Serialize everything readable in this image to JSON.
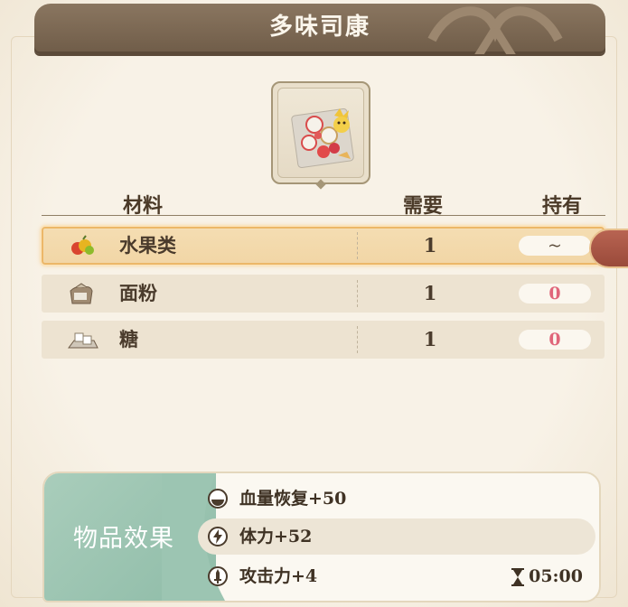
{
  "title": "多味司康",
  "table": {
    "headers": {
      "material": "材料",
      "need": "需要",
      "have": "持有"
    },
    "rows": [
      {
        "name": "水果类",
        "need": "1",
        "have": "~",
        "icon": "fruit-icon",
        "selected": true
      },
      {
        "name": "面粉",
        "need": "1",
        "have": "0",
        "icon": "flour-sack-icon",
        "selected": false
      },
      {
        "name": "糖",
        "need": "1",
        "have": "0",
        "icon": "sugar-icon",
        "selected": false
      }
    ]
  },
  "effects": {
    "label": "物品效果",
    "items": [
      {
        "text": "血量恢复+50",
        "icon": "hp-recovery-icon"
      },
      {
        "text": "体力+52",
        "icon": "stamina-lightning-icon"
      },
      {
        "text": "攻击力+4",
        "icon": "attack-sword-icon"
      }
    ],
    "duration": "05:00",
    "duration_icon": "hourglass-icon"
  },
  "colors": {
    "title_bar": "#7b6853",
    "row_selected_border": "#ecb768",
    "zero_value": "#e0667a",
    "effects_label_bg": "#9cc5b2"
  }
}
